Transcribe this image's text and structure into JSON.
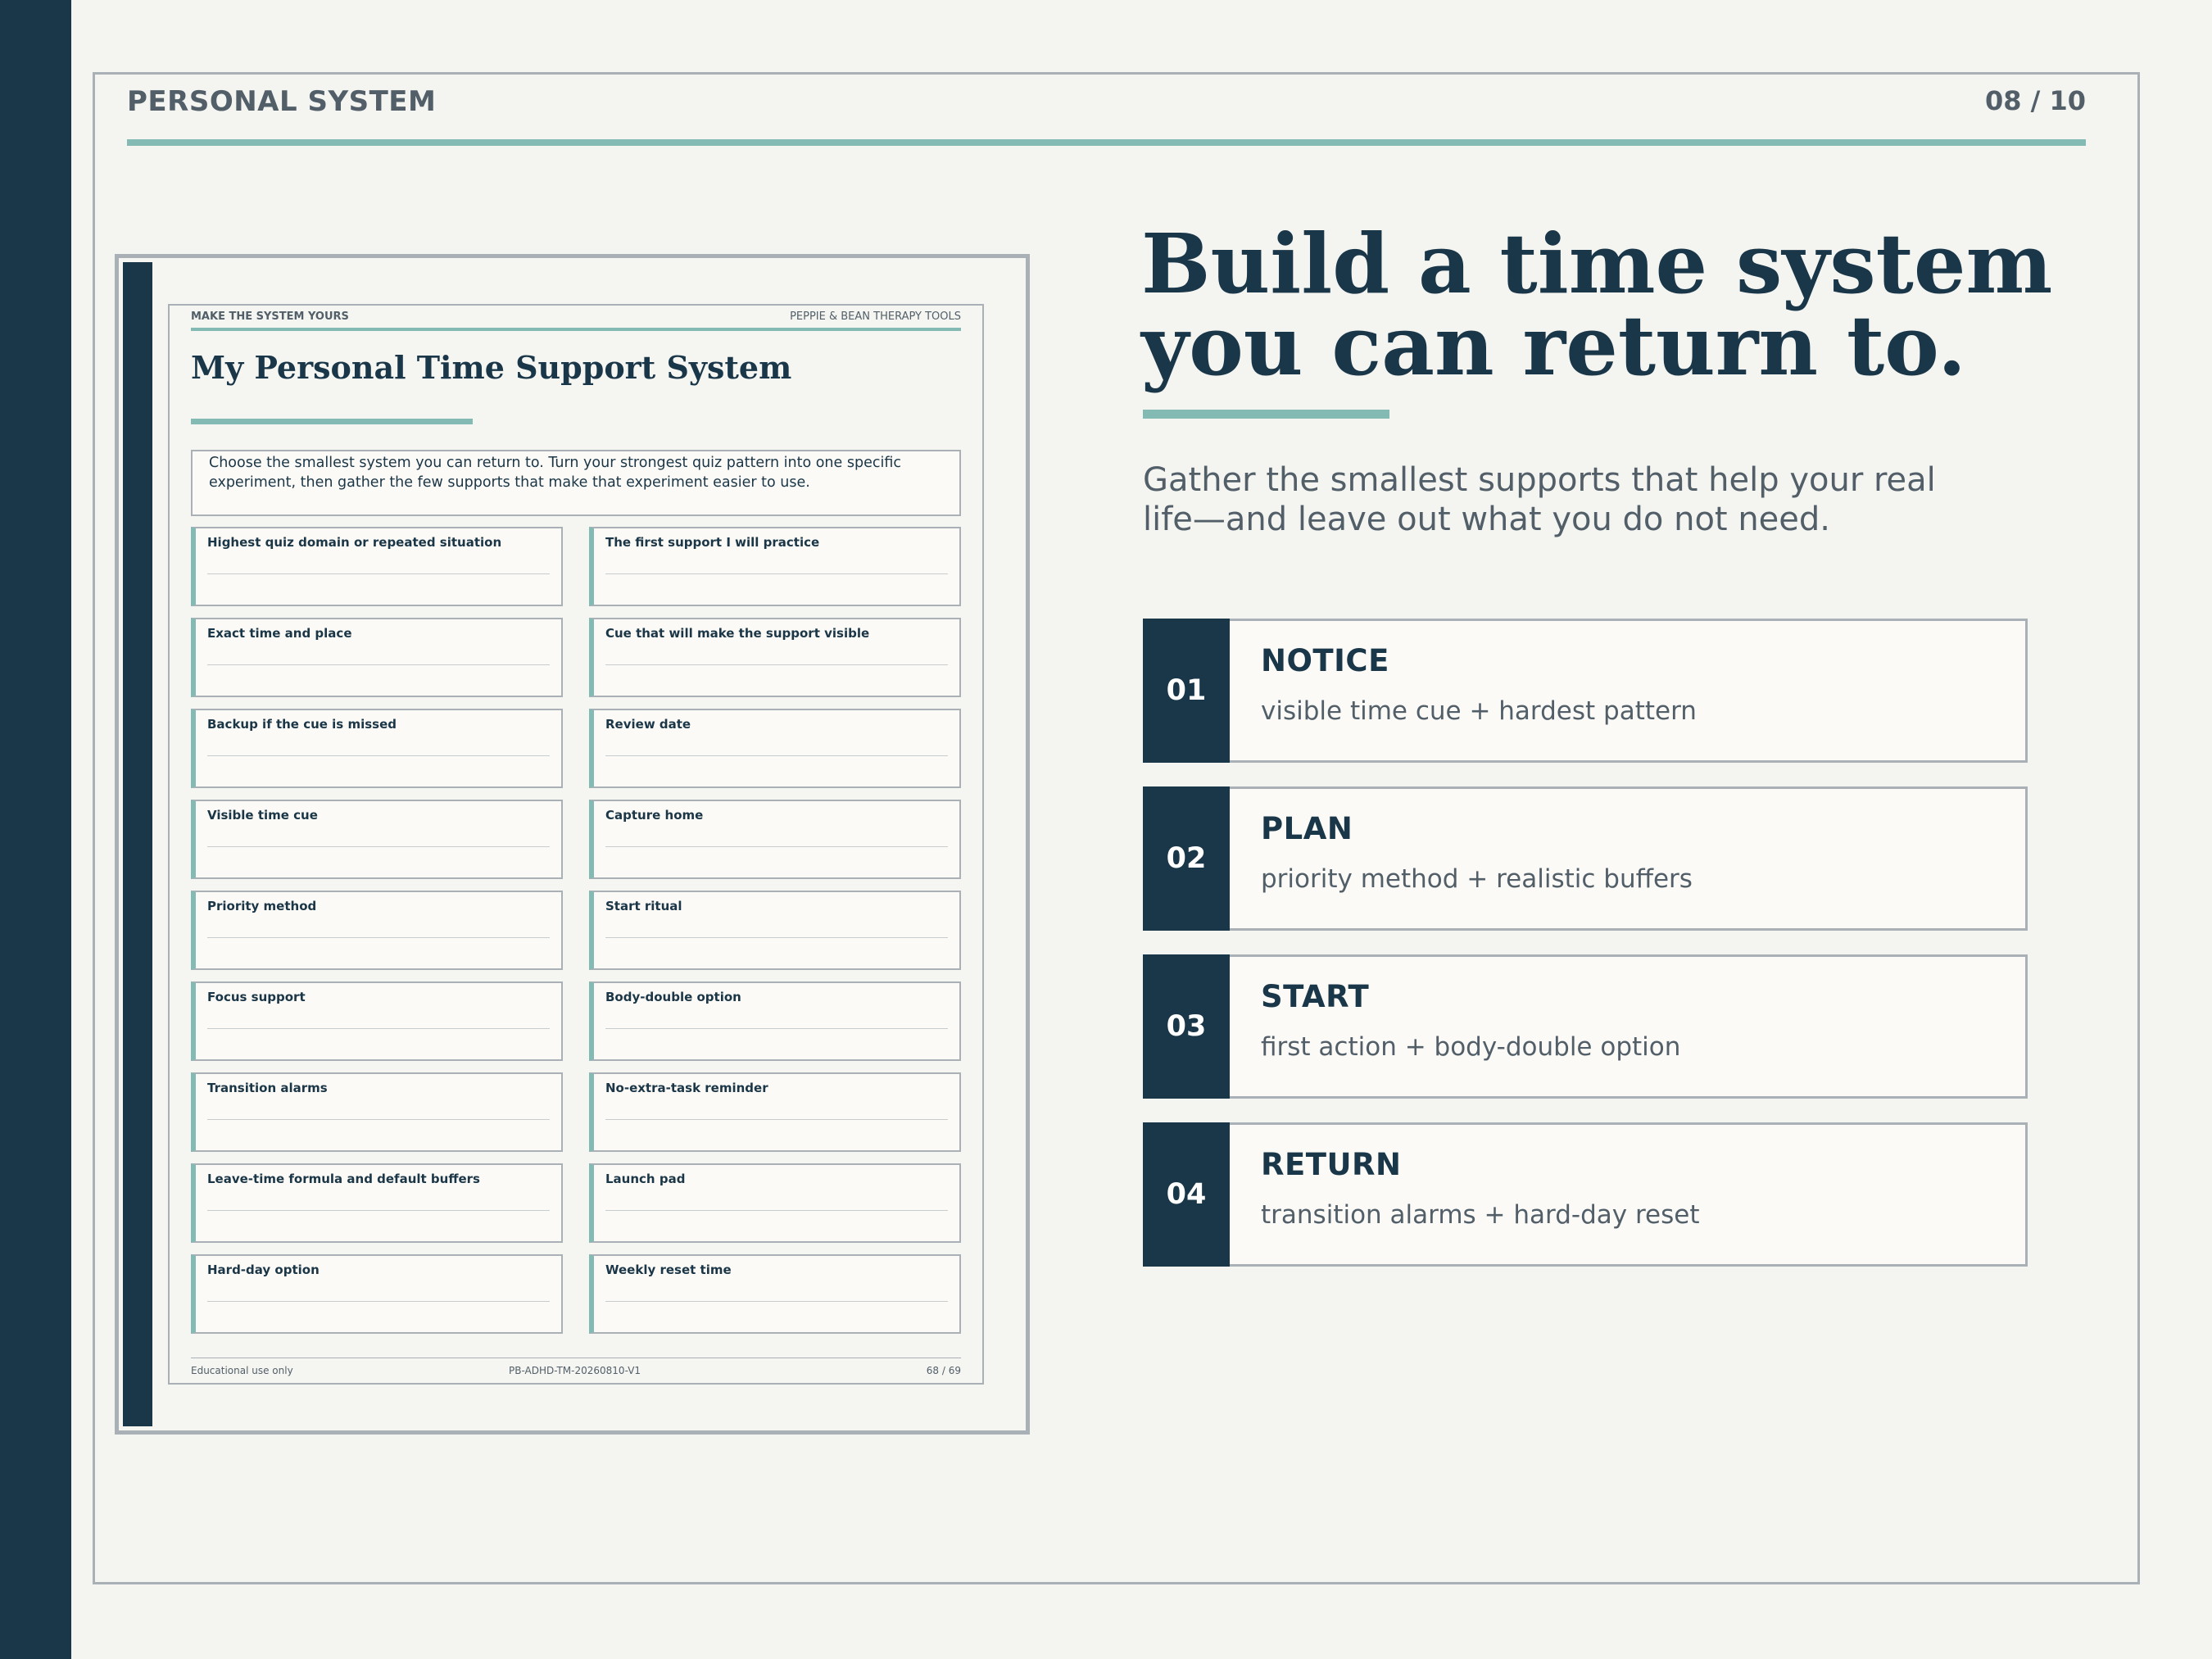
{
  "header": {
    "title": "PERSONAL SYSTEM",
    "page": "08 / 10"
  },
  "worksheet": {
    "kicker": "MAKE THE SYSTEM YOURS",
    "brand": "PEPPIE & BEAN THERAPY TOOLS",
    "title": "My Personal Time Support System",
    "intro": "Choose the smallest system you can return to. Turn your strongest quiz pattern into one specific experiment, then gather the few supports that make that experiment easier to use.",
    "fields": [
      "Highest quiz domain or repeated situation",
      "The first support I will practice",
      "Exact time and place",
      "Cue that will make the support visible",
      "Backup if the cue is missed",
      "Review date",
      "Visible time cue",
      "Capture home",
      "Priority method",
      "Start ritual",
      "Focus support",
      "Body-double option",
      "Transition alarms",
      "No-extra-task reminder",
      "Leave-time formula and default buffers",
      "Launch pad",
      "Hard-day option",
      "Weekly reset time"
    ],
    "footer": {
      "left": "Educational use only",
      "center": "PB-ADHD-TM-20260810-V1",
      "right": "68 / 69"
    }
  },
  "headline": {
    "line1": "Build a time system",
    "line2": "you can return to."
  },
  "subhead": "Gather the smallest supports that help your real life—and leave out what you do not need.",
  "steps": [
    {
      "num": "01",
      "title": "NOTICE",
      "desc": "visible time cue + hardest pattern"
    },
    {
      "num": "02",
      "title": "PLAN",
      "desc": "priority method + realistic buffers"
    },
    {
      "num": "03",
      "title": "START",
      "desc": "first action + body-double option"
    },
    {
      "num": "04",
      "title": "RETURN",
      "desc": "transition alarms + hard-day reset"
    }
  ]
}
